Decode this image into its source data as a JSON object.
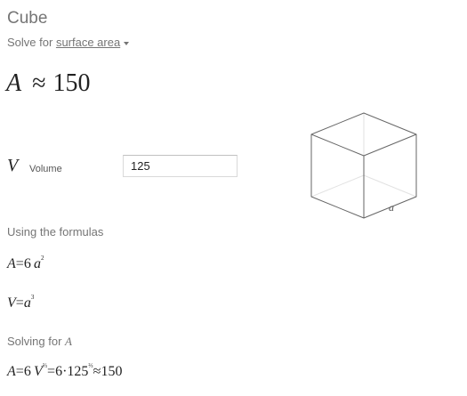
{
  "header": {
    "title": "Cube",
    "solve_prefix": "Solve for",
    "solve_target": "surface area"
  },
  "result": {
    "variable": "A",
    "approx": "≈",
    "value": "150"
  },
  "volume_field": {
    "symbol": "V",
    "label": "Volume",
    "value": "125"
  },
  "formulas": {
    "heading": "Using the formulas",
    "f1": {
      "lhs": "A",
      "eq": "=",
      "coef": "6",
      "var": "a",
      "exp": "2"
    },
    "f2": {
      "lhs": "V",
      "eq": "=",
      "var": "a",
      "exp": "3"
    }
  },
  "solving": {
    "heading": "Solving for",
    "variable": "A",
    "expr": {
      "lhs": "A",
      "eq": "=",
      "coef": "6",
      "var": "V",
      "exp": "⅔",
      "eq2": "=",
      "coef2": "6",
      "dot": "·",
      "num": "125",
      "exp2": "⅔",
      "approx": "≈",
      "value": "150"
    }
  },
  "diagram": {
    "edge_label": "a"
  }
}
